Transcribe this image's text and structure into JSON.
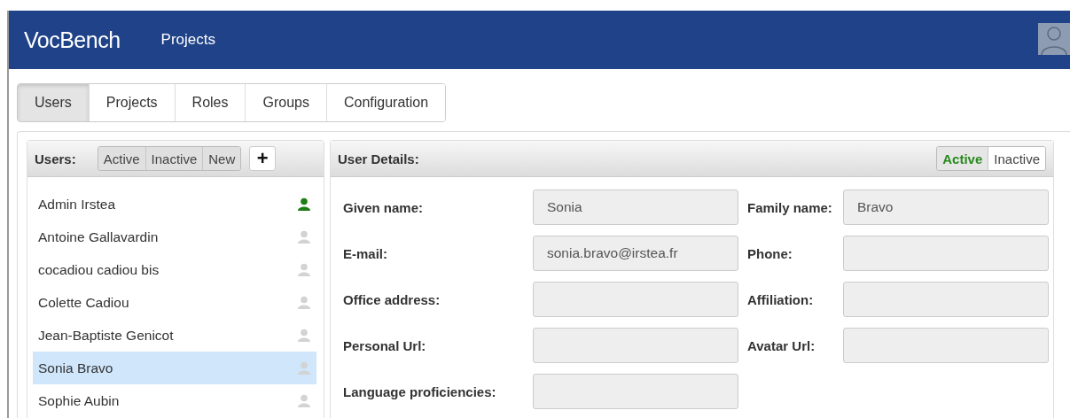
{
  "navbar": {
    "brand": "VocBench",
    "links": [
      "Projects"
    ]
  },
  "tabs": [
    {
      "label": "Users",
      "selected": true
    },
    {
      "label": "Projects",
      "selected": false
    },
    {
      "label": "Roles",
      "selected": false
    },
    {
      "label": "Groups",
      "selected": false
    },
    {
      "label": "Configuration",
      "selected": false
    }
  ],
  "users_panel": {
    "title": "Users:",
    "filters": [
      {
        "label": "Active",
        "selected": true
      },
      {
        "label": "Inactive",
        "selected": true
      },
      {
        "label": "New",
        "selected": true
      }
    ],
    "add_button": "+",
    "users": [
      {
        "name": "Admin Irstea",
        "active": true,
        "selected": false
      },
      {
        "name": "Antoine Gallavardin",
        "active": false,
        "selected": false
      },
      {
        "name": "cocadiou cadiou bis",
        "active": false,
        "selected": false
      },
      {
        "name": "Colette Cadiou",
        "active": false,
        "selected": false
      },
      {
        "name": "Jean-Baptiste Genicot",
        "active": false,
        "selected": false
      },
      {
        "name": "Sonia Bravo",
        "active": false,
        "selected": true
      },
      {
        "name": "Sophie Aubin",
        "active": false,
        "selected": false
      }
    ]
  },
  "details_panel": {
    "title": "User Details:",
    "status": [
      {
        "label": "Active",
        "selected": true
      },
      {
        "label": "Inactive",
        "selected": false
      }
    ],
    "fields": [
      {
        "label": "Given name:",
        "value": "Sonia"
      },
      {
        "label": "Family name:",
        "value": "Bravo"
      },
      {
        "label": "E-mail:",
        "value": "sonia.bravo@irstea.fr"
      },
      {
        "label": "Phone:"
      },
      {
        "label": "Office address:"
      },
      {
        "label": "Affiliation:"
      },
      {
        "label": "Personal Url:"
      },
      {
        "label": "Avatar Url:"
      },
      {
        "label": "Language proficiencies:"
      }
    ]
  }
}
